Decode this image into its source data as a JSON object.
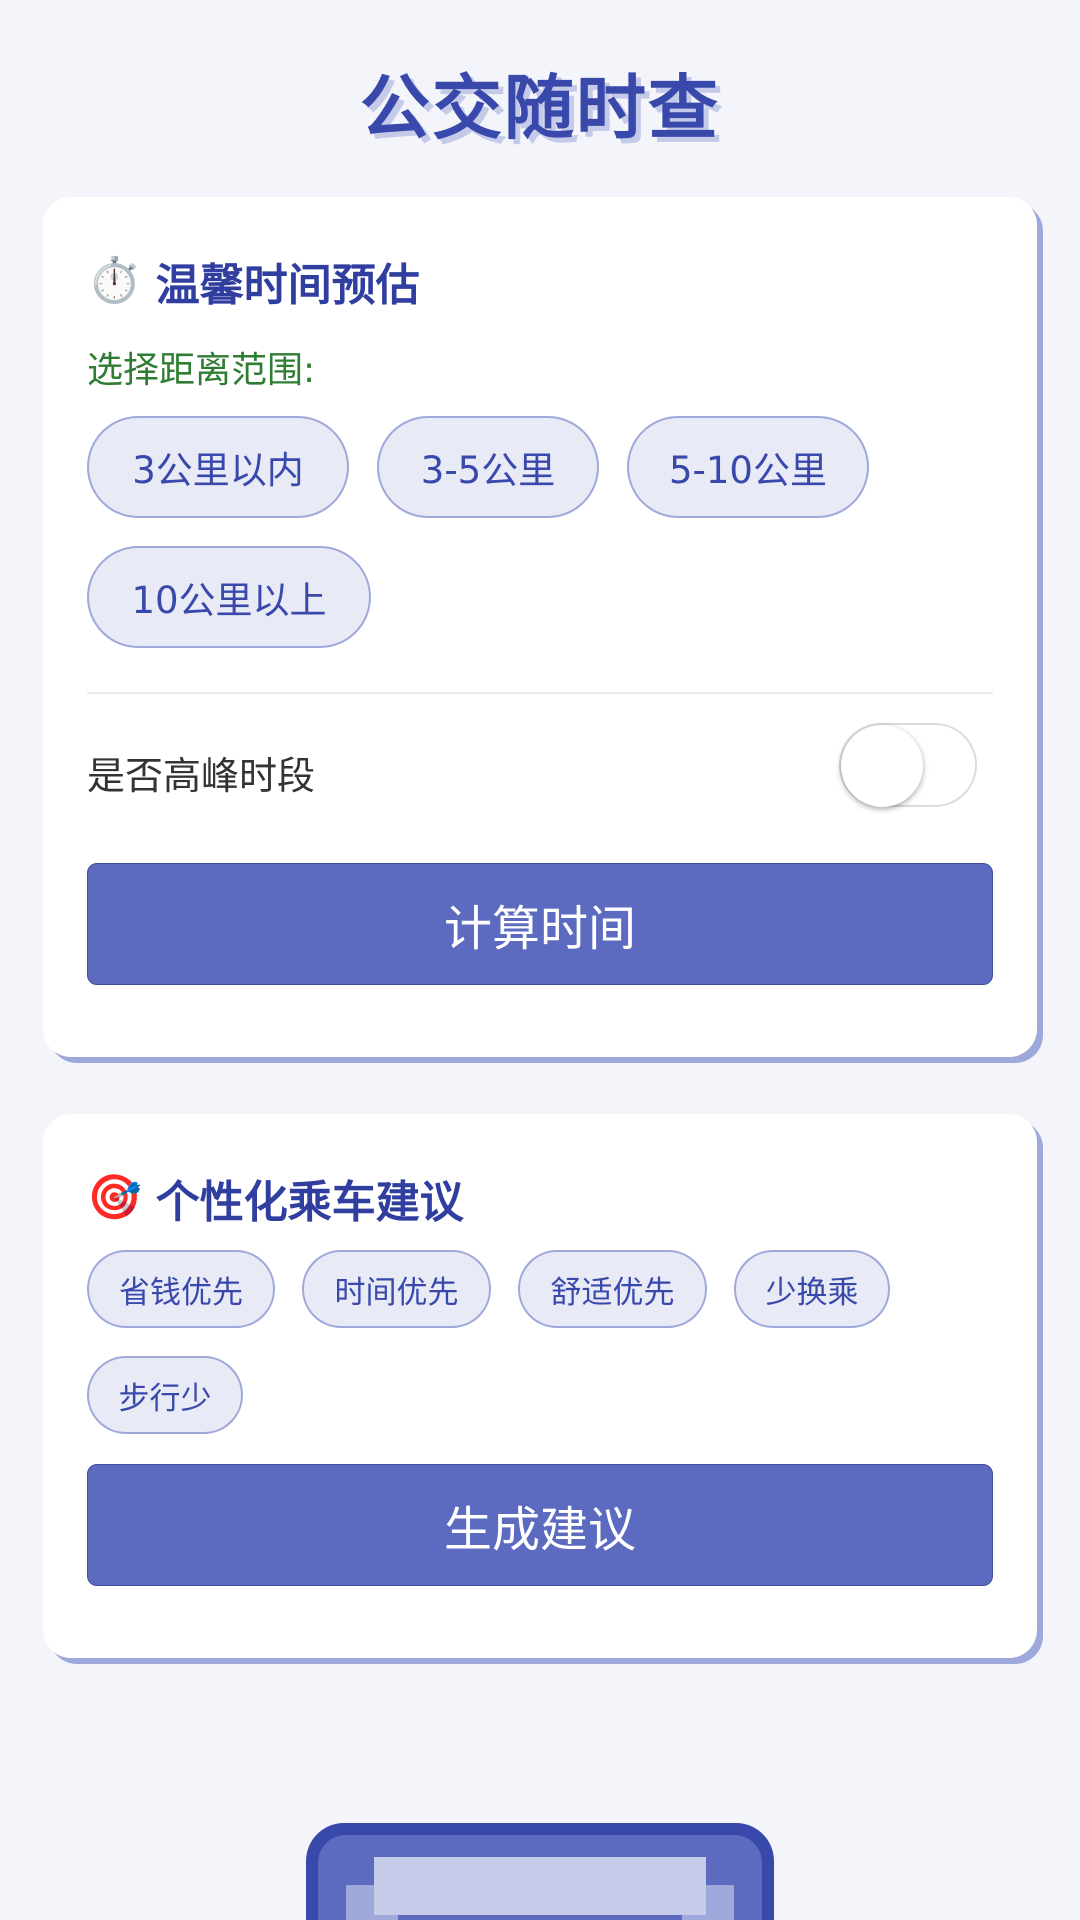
{
  "app": {
    "title": "公交随时查"
  },
  "time_card": {
    "icon": "stopwatch-icon",
    "icon_glyph": "⏱️",
    "title": "温馨时间预估",
    "distance_label": "选择距离范围:",
    "distance_options": [
      "3公里以内",
      "3-5公里",
      "5-10公里",
      "10公里以上"
    ],
    "peak_label": "是否高峰时段",
    "peak_on": false,
    "calc_button": "计算时间"
  },
  "advice_card": {
    "icon": "target-icon",
    "icon_glyph": "🎯",
    "title": "个性化乘车建议",
    "preferences": [
      "省钱优先",
      "时间优先",
      "舒适优先",
      "少换乘",
      "步行少"
    ],
    "generate_button": "生成建议"
  },
  "colors": {
    "primary": "#5c6bc0",
    "title": "#3949ab",
    "accent_green": "#2e7d32",
    "chip_bg": "#e8eaf6"
  }
}
